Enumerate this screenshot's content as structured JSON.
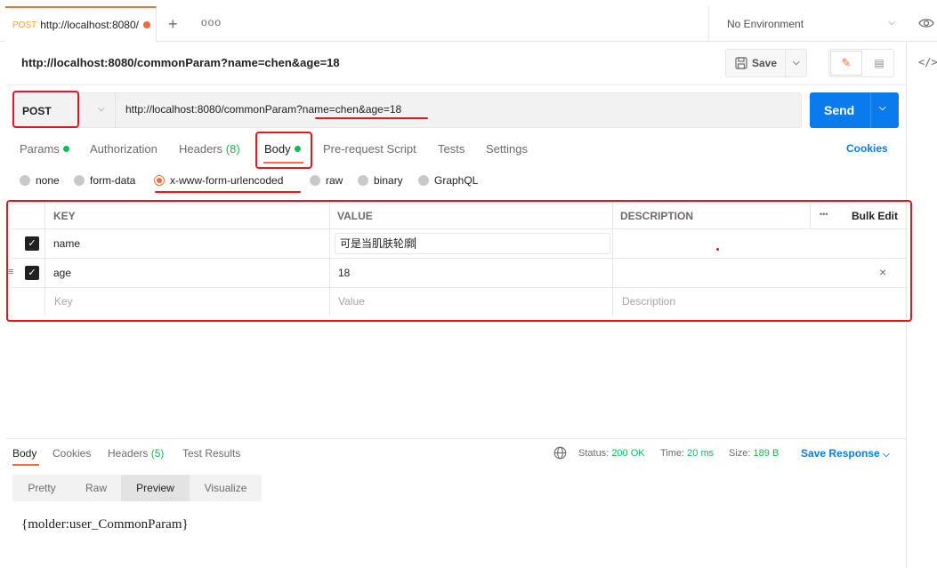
{
  "tabbar": {
    "tab_method": "POST",
    "tab_title": "http://localhost:8080/",
    "environment": "No Environment"
  },
  "request": {
    "title": "http://localhost:8080/commonParam?name=chen&age=18",
    "save_label": "Save",
    "method": "POST",
    "url_base": "http://localhost:8080/commonParam?",
    "url_query": "name=chen&age=18",
    "send_label": "Send"
  },
  "subtabs": {
    "params": "Params",
    "authorization": "Authorization",
    "headers": "Headers",
    "headers_count": "(8)",
    "body": "Body",
    "prerequest": "Pre-request Script",
    "tests": "Tests",
    "settings": "Settings",
    "cookies": "Cookies"
  },
  "body_types": [
    "none",
    "form-data",
    "x-www-form-urlencoded",
    "raw",
    "binary",
    "GraphQL"
  ],
  "body_type_selected": "x-www-form-urlencoded",
  "table": {
    "headers": {
      "key": "KEY",
      "value": "VALUE",
      "description": "DESCRIPTION",
      "more": "•••",
      "bulk_edit": "Bulk Edit"
    },
    "rows": [
      {
        "checked": true,
        "key": "name",
        "value": "可是当肌肤轮廓",
        "description": ""
      },
      {
        "checked": true,
        "key": "age",
        "value": "18",
        "description": ""
      }
    ],
    "placeholders": {
      "key": "Key",
      "value": "Value",
      "description": "Description"
    }
  },
  "response": {
    "tabs": {
      "body": "Body",
      "cookies": "Cookies",
      "headers": "Headers",
      "headers_count": "(5)",
      "test_results": "Test Results"
    },
    "status_label": "Status:",
    "status_value": "200 OK",
    "time_label": "Time:",
    "time_value": "20 ms",
    "size_label": "Size:",
    "size_value": "189 B",
    "save_response": "Save Response",
    "view_tabs": [
      "Pretty",
      "Raw",
      "Preview",
      "Visualize"
    ],
    "view_selected": "Preview",
    "body_text": "{molder:user_CommonParam}"
  },
  "colors": {
    "accent": "#f26b3a",
    "primary": "#097bed",
    "success": "#0cbb52",
    "annotation": "#e8141a"
  }
}
